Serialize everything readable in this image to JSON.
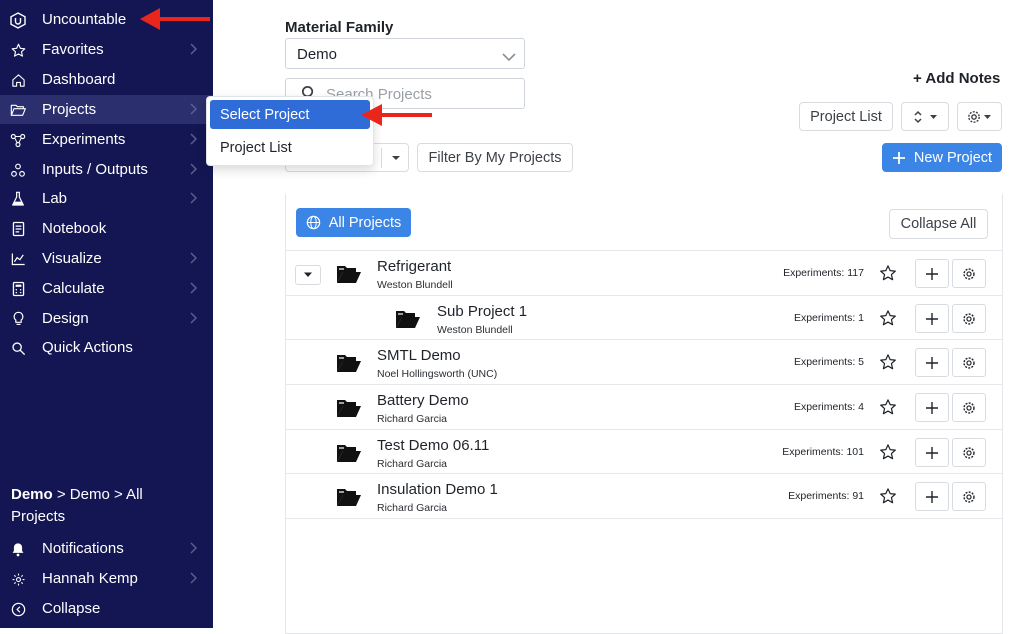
{
  "sidebar": {
    "brand": {
      "label": "Uncountable",
      "icon": "hex-logo-icon"
    },
    "items": [
      {
        "label": "Favorites",
        "icon": "star-icon",
        "chevron": true
      },
      {
        "label": "Dashboard",
        "icon": "home-icon",
        "chevron": false
      },
      {
        "label": "Projects",
        "icon": "folder-open-icon",
        "chevron": true,
        "active": true
      },
      {
        "label": "Experiments",
        "icon": "network-icon",
        "chevron": true
      },
      {
        "label": "Inputs / Outputs",
        "icon": "molecules-icon",
        "chevron": true
      },
      {
        "label": "Lab",
        "icon": "flask-icon",
        "chevron": true
      },
      {
        "label": "Notebook",
        "icon": "notebook-icon",
        "chevron": false
      },
      {
        "label": "Visualize",
        "icon": "chart-icon",
        "chevron": true
      },
      {
        "label": "Calculate",
        "icon": "calculator-icon",
        "chevron": true
      },
      {
        "label": "Design",
        "icon": "bulb-icon",
        "chevron": true
      },
      {
        "label": "Quick Actions",
        "icon": "search-icon",
        "chevron": false
      }
    ],
    "breadcrumb": {
      "bold": "Demo",
      "rest": " > Demo > All Projects"
    },
    "bottom": [
      {
        "label": "Notifications",
        "icon": "bell-icon",
        "chevron": true
      },
      {
        "label": "Hannah Kemp",
        "icon": "gear-icon",
        "chevron": true
      },
      {
        "label": "Collapse",
        "icon": "collapse-icon",
        "chevron": false
      }
    ]
  },
  "flyout": {
    "items": [
      "Select Project",
      "Project List"
    ]
  },
  "main": {
    "material_family_label": "Material Family",
    "material_family_value": "Demo",
    "search_placeholder": "Search Projects",
    "add_notes": "+ Add Notes",
    "project_list_button": "Project List",
    "filter_button": "Filter By My Projects",
    "new_project_button": "New Project",
    "all_projects_button": "All Projects",
    "collapse_all_button": "Collapse All"
  },
  "projects": [
    {
      "name": "Refrigerant",
      "owner": "Weston Blundell",
      "experiments": "Experiments: 117",
      "expandable": true,
      "level": 0
    },
    {
      "name": "Sub Project 1",
      "owner": "Weston Blundell",
      "experiments": "Experiments: 1",
      "expandable": false,
      "level": 1
    },
    {
      "name": "SMTL Demo",
      "owner": "Noel Hollingsworth (UNC)",
      "experiments": "Experiments: 5",
      "expandable": false,
      "level": 0
    },
    {
      "name": "Battery Demo",
      "owner": "Richard Garcia",
      "experiments": "Experiments: 4",
      "expandable": false,
      "level": 0
    },
    {
      "name": "Test Demo 06.11",
      "owner": "Richard Garcia",
      "experiments": "Experiments: 101",
      "expandable": false,
      "level": 0
    },
    {
      "name": "Insulation Demo 1",
      "owner": "Richard Garcia",
      "experiments": "Experiments: 91",
      "expandable": false,
      "level": 0
    }
  ],
  "colors": {
    "sidebar_bg": "#141653",
    "primary": "#3a85e6",
    "menu_selected": "#2f6cd8",
    "annotation_arrow": "#e8261c"
  }
}
